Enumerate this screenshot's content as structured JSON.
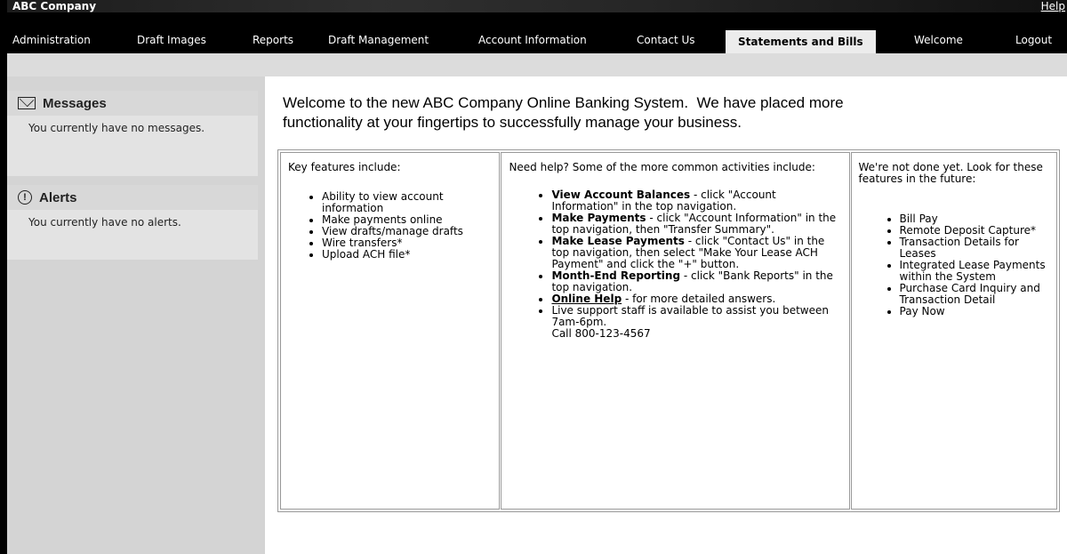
{
  "header": {
    "company": "ABC Company",
    "help": "Help"
  },
  "nav": {
    "items": [
      "Administration",
      "Draft Images",
      "Reports",
      "Draft Management",
      "Account Information",
      "Contact Us",
      "Statements and Bills",
      "Welcome",
      "Logout"
    ],
    "active": "Statements and Bills"
  },
  "sidebar": {
    "messages": {
      "title": "Messages",
      "text": "You currently have no messages."
    },
    "alerts": {
      "title": "Alerts",
      "text": "You currently have no alerts."
    }
  },
  "welcome": {
    "line1": "Welcome to the new ABC Company Online Banking System.  We have placed more",
    "line2": "functionality at your fingertips to successfully manage your business."
  },
  "columns": {
    "features": {
      "intro": "Key features include:",
      "items": [
        "Ability to view account information",
        "Make payments online",
        "View drafts/manage drafts",
        "Wire transfers*",
        "Upload ACH file*"
      ]
    },
    "help": {
      "intro": "Need help? Some of the more common activities include:",
      "items": [
        {
          "bold": "View Account Balances",
          "text": " - click \"Account Information\" in the top navigation."
        },
        {
          "bold": "Make Payments",
          "text": " - click \"Account Information\" in the top navigation, then \"Transfer Summary\"."
        },
        {
          "bold": "Make Lease Payments",
          "text": " - click \"Contact Us\" in the top navigation, then select \"Make Your Lease ACH Payment\" and click the \"+\" button."
        },
        {
          "bold": "Month-End Reporting",
          "text": " - click \"Bank Reports\" in the top navigation."
        },
        {
          "link": "Online Help",
          "text": " - for more detailed answers."
        },
        {
          "text": "Live support staff is available to assist you between 7am-6pm.",
          "extra": "Call 800-123-4567"
        }
      ]
    },
    "future": {
      "intro": "We're not done yet. Look for these features in the future:",
      "items": [
        "Bill Pay",
        "Remote Deposit Capture*",
        "Transaction Details for Leases",
        "Integrated Lease Payments within the System",
        "Purchase Card Inquiry and Transaction Detail",
        "Pay Now"
      ]
    }
  }
}
